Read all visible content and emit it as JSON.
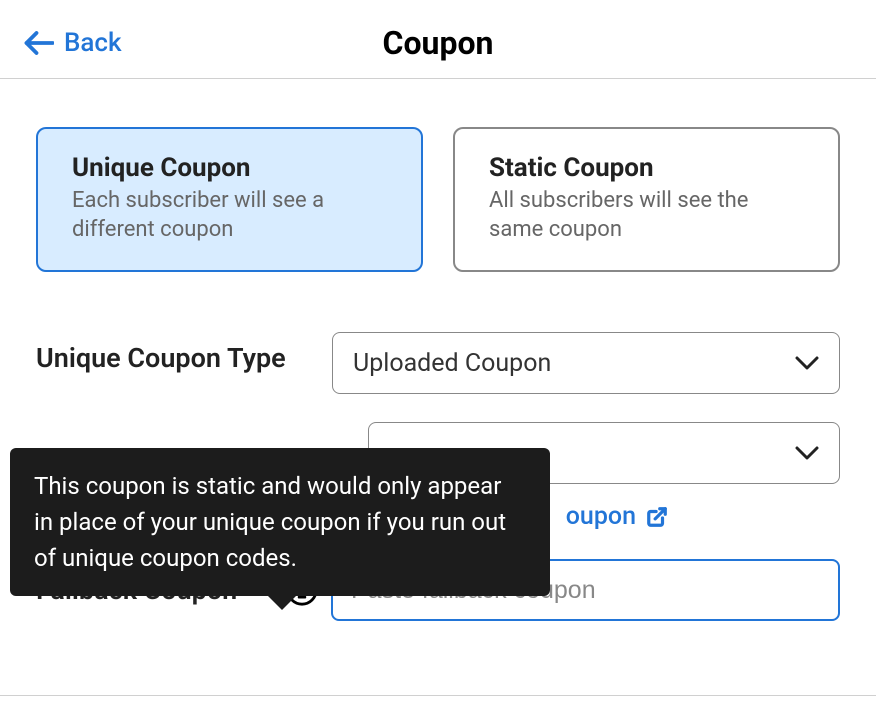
{
  "header": {
    "back_label": "Back",
    "title": "Coupon"
  },
  "options": {
    "unique": {
      "title": "Unique Coupon",
      "desc": "Each subscriber will see a different coupon"
    },
    "static": {
      "title": "Static Coupon",
      "desc": "All subscribers will see the same coupon"
    }
  },
  "form": {
    "type_label": "Unique Coupon Type",
    "type_value": "Uploaded Coupon",
    "second_select_value": "",
    "link_partial": "oupon",
    "fallback_label": "Fallback Coupon",
    "fallback_placeholder": "Paste fallback coupon"
  },
  "tooltip": {
    "text": "This coupon is static and would only appear in place of your unique coupon if you run out of unique coupon codes."
  }
}
